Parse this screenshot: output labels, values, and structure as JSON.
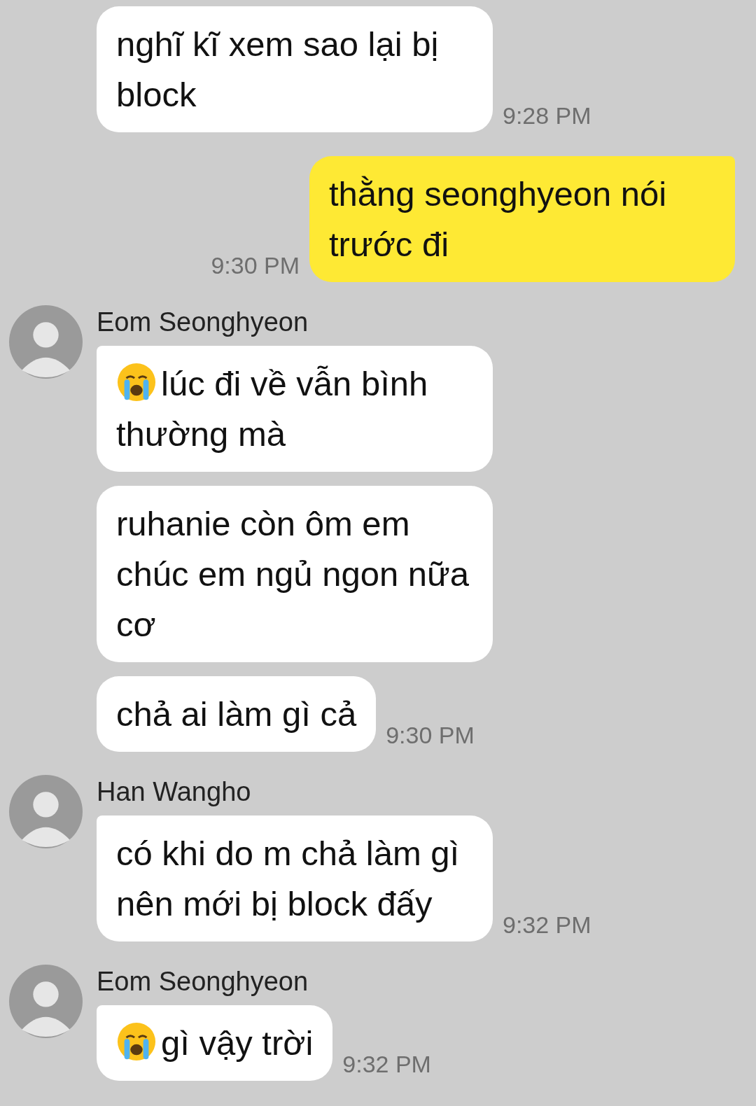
{
  "messages": [
    {
      "kind": "received",
      "text": "nghĩ kĩ xem sao lại bị block",
      "time": "9:28 PM",
      "emoji": false
    },
    {
      "kind": "sent",
      "text": "thằng seonghyeon nói trước đi",
      "time": "9:30 PM"
    },
    {
      "kind": "received",
      "sender": "Eom Seonghyeon",
      "text": "lúc đi về vẫn bình thường mà",
      "emoji": true
    },
    {
      "kind": "received",
      "text": "ruhanie còn ôm em chúc em ngủ ngon nữa cơ",
      "emoji": false
    },
    {
      "kind": "received",
      "text": "chả ai làm gì cả",
      "time": "9:30 PM",
      "emoji": false
    },
    {
      "kind": "received",
      "sender": "Han Wangho",
      "text": "có khi do m chả làm gì nên mới bị block đấy",
      "time": "9:32 PM",
      "emoji": false
    },
    {
      "kind": "received",
      "sender": "Eom Seonghyeon",
      "text": "gì vậy trời",
      "time": "9:32 PM",
      "emoji": true
    }
  ]
}
